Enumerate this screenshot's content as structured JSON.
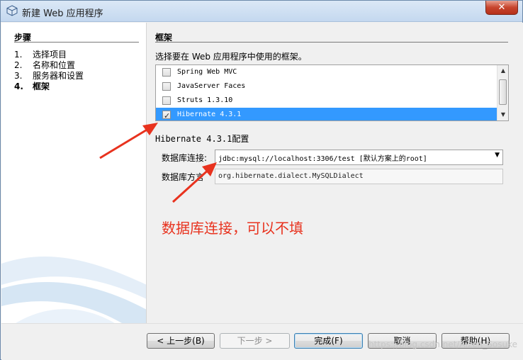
{
  "window": {
    "title": "新建 Web 应用程序",
    "close_label": "✕"
  },
  "steps": {
    "title": "步骤",
    "items": [
      {
        "num": "1.",
        "label": "选择项目"
      },
      {
        "num": "2.",
        "label": "名称和位置"
      },
      {
        "num": "3.",
        "label": "服务器和设置"
      },
      {
        "num": "4.",
        "label": "框架"
      }
    ]
  },
  "main": {
    "title": "框架",
    "instruction": "选择要在 Web 应用程序中使用的框架。",
    "frameworks": [
      {
        "label": "Spring Web MVC",
        "checked": false
      },
      {
        "label": "JavaServer Faces",
        "checked": false
      },
      {
        "label": "Struts 1.3.10",
        "checked": false
      },
      {
        "label": "Hibernate 4.3.1",
        "checked": true
      }
    ],
    "config_title_prefix": "Hibernate 4.3.1",
    "config_title_suffix": "配置",
    "db_label": "数据库连接:",
    "db_value": "jdbc:mysql://localhost:3306/test [默认方案上的root]",
    "dialect_label": "数据库方言",
    "dialect_value": "org.hibernate.dialect.MySQLDialect"
  },
  "annotation": "数据库连接，可以不填",
  "buttons": {
    "back": "< 上一步(B)",
    "next": "下一步 >",
    "finish": "完成(F)",
    "cancel": "取消",
    "help": "帮助(H)"
  },
  "watermark": "https://blog.csdn.net/Aizen_Sosuke",
  "colors": {
    "selection": "#3399ff",
    "annotation": "#e8321e"
  }
}
